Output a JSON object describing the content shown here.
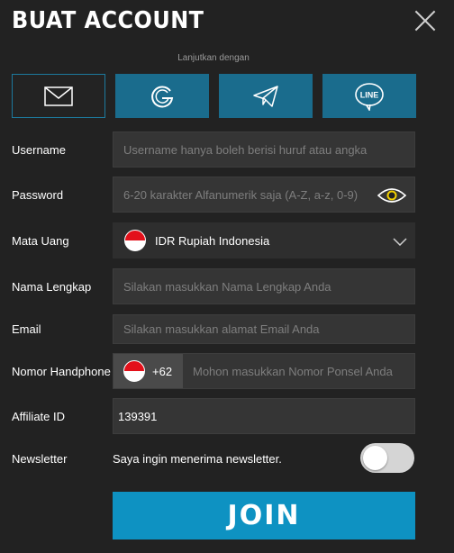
{
  "header": {
    "title": "BUAT ACCOUNT",
    "close_icon": "close-icon"
  },
  "social": {
    "label": "Lanjutkan dengan",
    "buttons": [
      {
        "name": "email",
        "icon": "envelope-icon",
        "active": true
      },
      {
        "name": "google",
        "icon": "google-icon",
        "active": false
      },
      {
        "name": "telegram",
        "icon": "telegram-icon",
        "active": false
      },
      {
        "name": "line",
        "icon": "line-icon",
        "text": "LINE",
        "active": false
      }
    ]
  },
  "form": {
    "username": {
      "label": "Username",
      "placeholder": "Username hanya boleh berisi huruf atau angka"
    },
    "password": {
      "label": "Password",
      "placeholder": "6-20 karakter Alfanumerik saja (A-Z, a-z, 0-9)"
    },
    "currency": {
      "label": "Mata Uang",
      "value": "IDR Rupiah Indonesia"
    },
    "fullname": {
      "label": "Nama Lengkap",
      "placeholder": "Silakan masukkan Nama Lengkap Anda"
    },
    "email": {
      "label": "Email",
      "placeholder": "Silakan masukkan alamat Email Anda"
    },
    "phone": {
      "label": "Nomor Handphone",
      "country_code": "+62",
      "placeholder": "Mohon masukkan Nomor Ponsel Anda"
    },
    "affiliate": {
      "label": "Affiliate ID",
      "value": "139391"
    },
    "newsletter": {
      "label": "Newsletter",
      "text": "Saya ingin menerima newsletter.",
      "enabled": false
    }
  },
  "submit": {
    "label": "JOIN"
  },
  "colors": {
    "background": "#222222",
    "accent": "#0e92c2",
    "social_bg": "#1a6c8d",
    "field_bg": "#353535",
    "eye_accent": "#f2d000"
  }
}
